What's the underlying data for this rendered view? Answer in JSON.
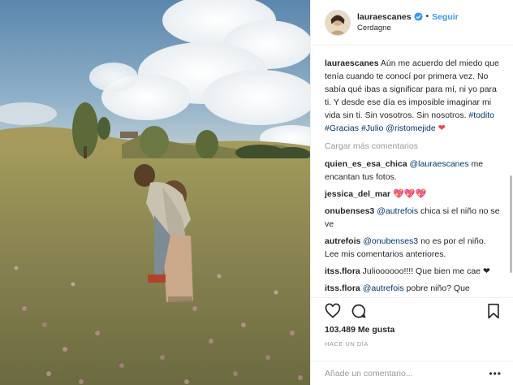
{
  "header": {
    "username": "lauraescanes",
    "separator": "•",
    "follow_label": "Seguir",
    "location": "Cerdagne",
    "avatar_icon": "profile-avatar",
    "verified_icon": "verified-badge-icon",
    "verified_color": "#3897f0"
  },
  "caption": {
    "username": "lauraescanes",
    "text": " Aún me acuerdo del miedo que tenía cuando te conocí por primera vez. No sabía qué ibas a significar para mí, ni yo para ti. Y desde ese día es imposible imaginar mi vida sin ti. Sin vosotros. Sin nosotros. ",
    "hashtag1": "#todito",
    "hashtag2": "#Gracias",
    "hashtag3": "#Julio",
    "mention": "@ristomejide",
    "emoji": "❤"
  },
  "load_more": "Cargar más comentarios",
  "comments": [
    {
      "user": "quien_es_esa_chica",
      "mention": "@lauraescanes",
      "text": " me encantan tus fotos."
    },
    {
      "user": "jessica_del_mar",
      "text": "💖💖💖"
    },
    {
      "user": "onubenses3",
      "mention": "@autrefois",
      "text": " chica si el niño no se ve"
    },
    {
      "user": "autrefois",
      "mention": "@onubenses3",
      "text": " no es por el niño. Lee mis comentarios anteriores."
    },
    {
      "user": "itss.flora",
      "text": " Julioooooo!!!! Que bien me cae ❤"
    },
    {
      "user": "itss.flora",
      "mention": "@autrefois",
      "text": " pobre niño? Que"
    }
  ],
  "actions": {
    "like_icon": "heart-outline-icon",
    "comment_icon": "comment-bubble-icon",
    "save_icon": "bookmark-icon",
    "likes": "103.489 Me gusta",
    "time_ago": "HACE UN DÍA"
  },
  "add_comment": {
    "placeholder": "Añade un comentario...",
    "more_icon": "more-options-icon",
    "more_label": "•••"
  },
  "colors": {
    "link": "#003569",
    "follow": "#3897f0",
    "heart": "#ed4956",
    "muted": "#999999"
  }
}
